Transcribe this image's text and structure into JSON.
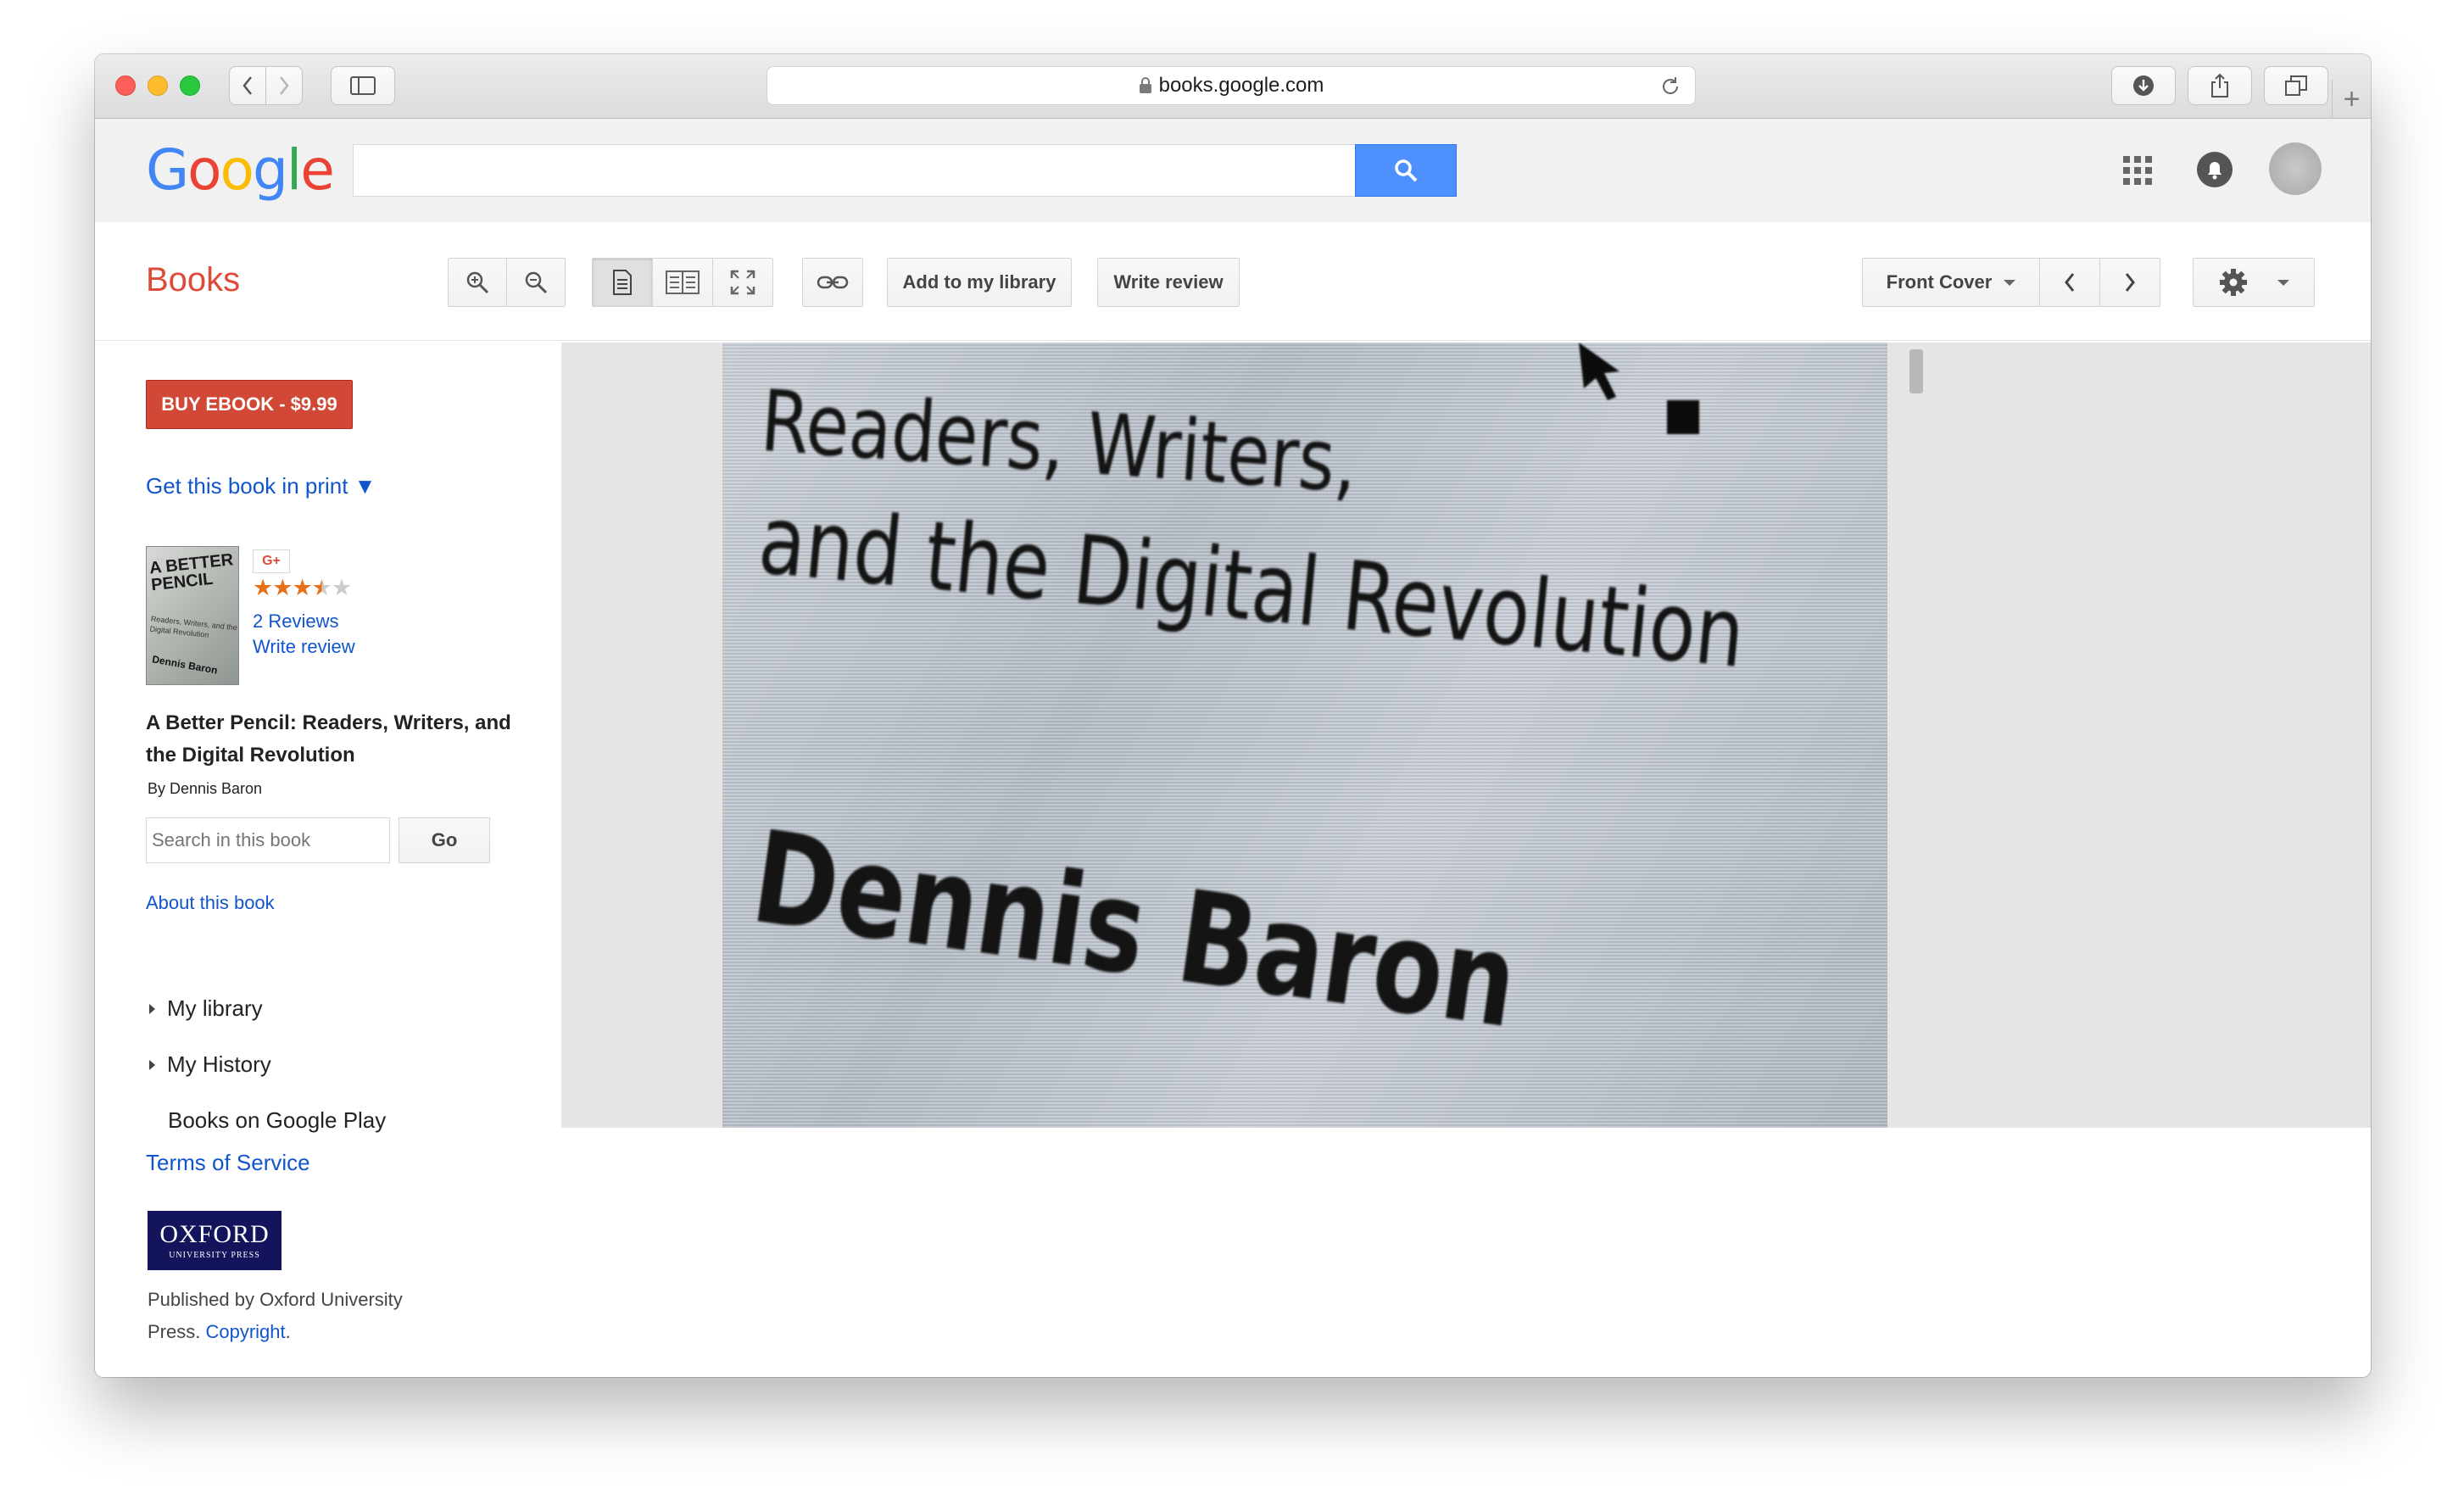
{
  "browser": {
    "url": "books.google.com",
    "new_tab_label": "+"
  },
  "google": {
    "logo_letters": [
      "G",
      "o",
      "o",
      "g",
      "l",
      "e"
    ],
    "logo_colors": [
      "#4285f4",
      "#ea4335",
      "#fbbc05",
      "#4285f4",
      "#34a853",
      "#ea4335"
    ],
    "search_value": ""
  },
  "toolbar": {
    "books_title": "Books",
    "add_library_label": "Add to my library",
    "write_review_label": "Write review",
    "front_cover_label": "Front Cover"
  },
  "sidebar": {
    "buy_label": "BUY EBOOK - $9.99",
    "get_print_label": "Get this book in print ▼",
    "cover_text": {
      "title": "A BETTER PENCIL",
      "subtitle": "Readers, Writers, and the Digital Revolution",
      "author": "Dennis Baron"
    },
    "gplus_badge": "G+",
    "rating": 3.5,
    "rating_max": 5,
    "reviews_label": "2 Reviews",
    "write_review_label": "Write review",
    "book_title": "A Better Pencil: Readers, Writers, and the Digital Revolution",
    "author_line": "By Dennis Baron",
    "search_placeholder": "Search in this book",
    "go_label": "Go",
    "about_label": "About this book",
    "nav": [
      "My library",
      "My History",
      "Books on Google Play"
    ],
    "terms_label": "Terms of Service",
    "publisher_logo": {
      "line1": "OXFORD",
      "line2": "UNIVERSITY PRESS"
    },
    "publisher_text": "Published by Oxford University Press.",
    "copyright_label": "Copyright",
    "copyright_suffix": "."
  },
  "viewer": {
    "lines": [
      "Readers, Writers,",
      "and the Digital Revolution",
      "Dennis Baron"
    ]
  },
  "colors": {
    "accent_red": "#dd4b39",
    "buy_button": "#d14836",
    "link_blue": "#1155cc",
    "search_blue": "#4d90fe",
    "star_on": "#e7711b",
    "oxford_navy": "#14145c"
  }
}
